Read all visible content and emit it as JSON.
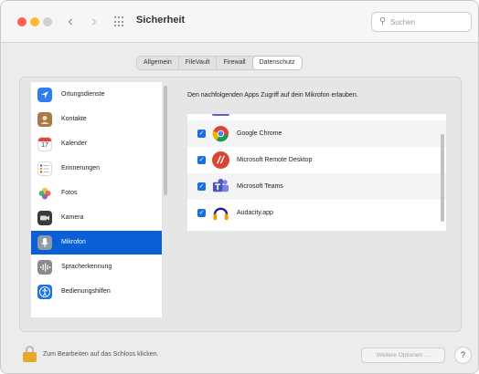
{
  "window": {
    "title": "Sicherheit"
  },
  "search": {
    "placeholder": "Suchen"
  },
  "tabs": [
    {
      "label": "Allgemein"
    },
    {
      "label": "FileVault"
    },
    {
      "label": "Firewall"
    },
    {
      "label": "Datenschutz",
      "active": true
    }
  ],
  "sidebar": {
    "items": [
      {
        "label": "Ortungsdienste",
        "icon": "location-arrow-icon"
      },
      {
        "label": "Kontakte",
        "icon": "contacts-book-icon"
      },
      {
        "label": "Kalender",
        "icon": "calendar-icon",
        "icon_text": "17"
      },
      {
        "label": "Erinnerungen",
        "icon": "reminders-list-icon"
      },
      {
        "label": "Fotos",
        "icon": "photos-flower-icon"
      },
      {
        "label": "Kamera",
        "icon": "camera-icon"
      },
      {
        "label": "Mikrofon",
        "icon": "microphone-icon",
        "selected": true
      },
      {
        "label": "Spracherkennung",
        "icon": "speech-recognition-icon"
      },
      {
        "label": "Bedienungshilfen",
        "icon": "accessibility-icon"
      }
    ]
  },
  "main": {
    "description": "Den nachfolgenden Apps Zugriff auf dein Mikrofon erlauben.",
    "apps": [
      {
        "label": "Google Chrome",
        "checked": true,
        "icon": "chrome-icon"
      },
      {
        "label": "Microsoft Remote Desktop",
        "checked": true,
        "icon": "remote-desktop-icon"
      },
      {
        "label": "Microsoft Teams",
        "checked": true,
        "icon": "teams-icon"
      },
      {
        "label": "Audacity.app",
        "checked": true,
        "icon": "audacity-icon"
      }
    ]
  },
  "footer": {
    "lock_text": "Zum Bearbeiten auf das Schloss klicken.",
    "more_button": "Weitere Optionen …",
    "help_button": "?"
  },
  "colors": {
    "accent": "#0a5fd6",
    "checkbox": "#1a6fe0",
    "lock": "#e8a72d"
  }
}
